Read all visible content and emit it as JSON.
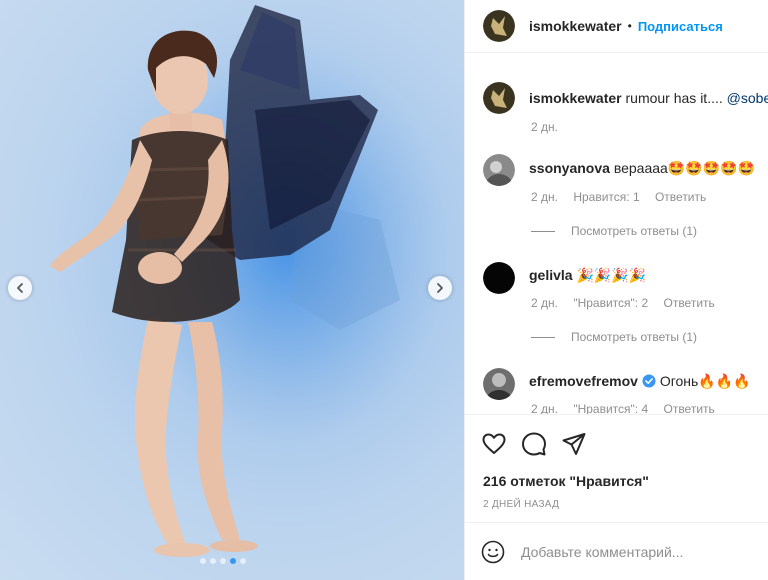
{
  "header": {
    "username": "ismokkewater",
    "separator": "•",
    "follow_label": "Подписаться"
  },
  "caption": {
    "username": "ismokkewater",
    "text": "rumour has it.... ",
    "mention": "@sobe",
    "time": "2 дн."
  },
  "comments": [
    {
      "username": "ssonyanova",
      "text": "вераааа🤩🤩🤩🤩🤩",
      "time": "2 дн.",
      "likes": "Нравится: 1",
      "reply": "Ответить",
      "view_replies": "Посмотреть ответы (1)"
    },
    {
      "username": "gelivla",
      "text": "🎉🎉🎉🎉",
      "time": "2 дн.",
      "likes": "\"Нравится\": 2",
      "reply": "Ответить",
      "view_replies": "Посмотреть ответы (1)"
    },
    {
      "username": "efremovefremov",
      "verified": true,
      "text": "Огонь🔥🔥🔥",
      "time": "2 дн.",
      "likes": "\"Нравится\": 4",
      "reply": "Ответить"
    }
  ],
  "actions": {
    "icons": [
      "heart-icon",
      "comment-icon",
      "share-icon"
    ],
    "likes": "216 отметок \"Нравится\"",
    "posted": "2 ДНЕЙ НАЗАД"
  },
  "comment_input": {
    "placeholder": "Добавьте комментарий..."
  },
  "carousel": {
    "slide_count": 5,
    "active_index": 3
  },
  "colors": {
    "accent": "#0095f6",
    "active_dot": "#3897f0",
    "muted": "#8e8e8e",
    "text": "#262626",
    "verified": "#3897f0"
  }
}
